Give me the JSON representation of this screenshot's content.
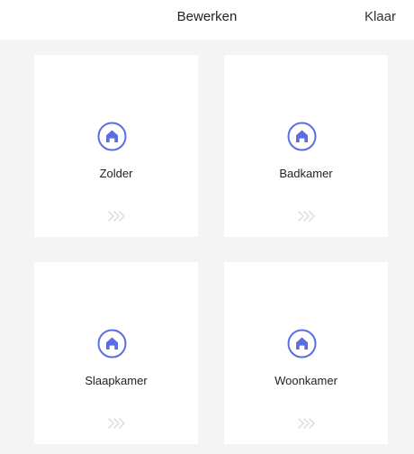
{
  "header": {
    "title": "Bewerken",
    "done_label": "Klaar"
  },
  "colors": {
    "accent": "#5b6ee1",
    "background": "#f4f4f4",
    "card": "#ffffff"
  },
  "rooms": [
    {
      "name": "Zolder",
      "icon": "home-icon"
    },
    {
      "name": "Badkamer",
      "icon": "home-icon"
    },
    {
      "name": "Slaapkamer",
      "icon": "home-icon"
    },
    {
      "name": "Woonkamer",
      "icon": "home-icon"
    }
  ]
}
